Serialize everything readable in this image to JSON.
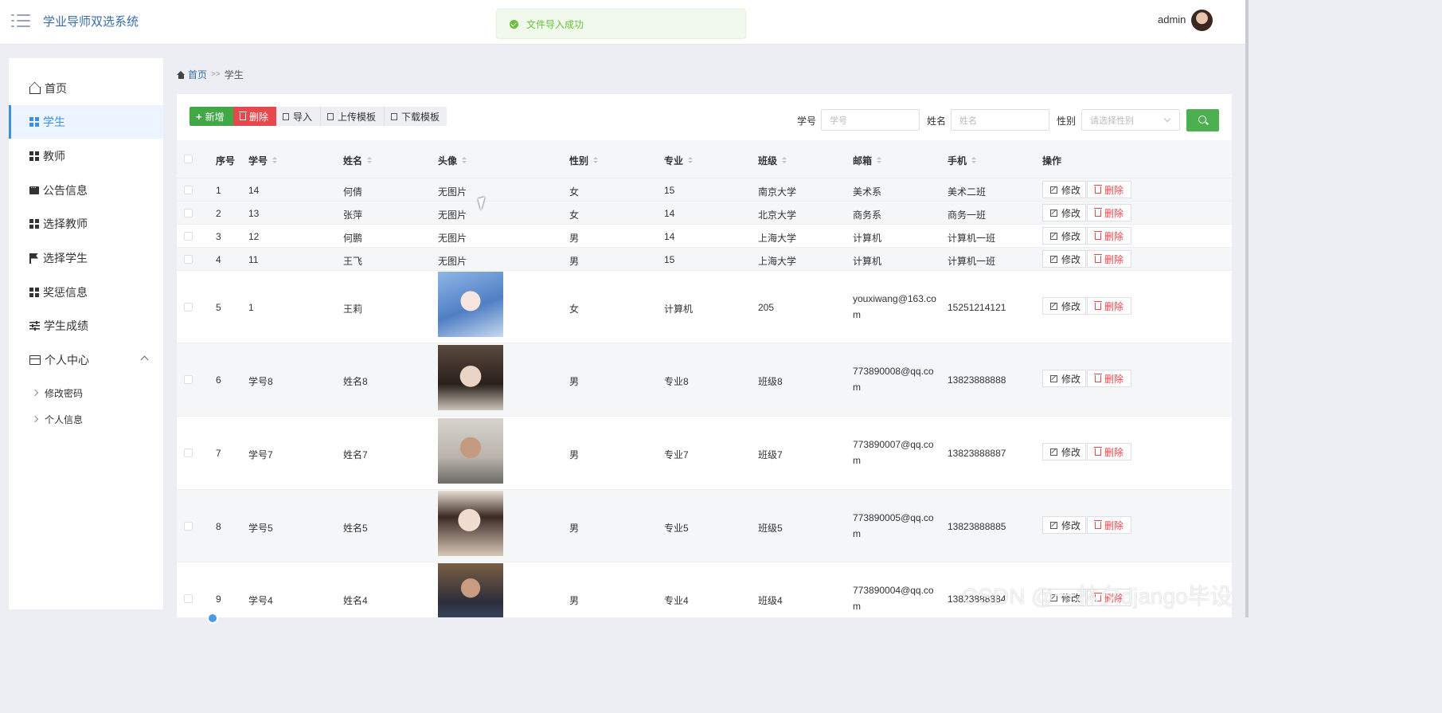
{
  "app": {
    "title": "学业导师双选系统",
    "user": "admin"
  },
  "toast": {
    "message": "文件导入成功"
  },
  "sidebar": {
    "items": [
      {
        "label": "首页",
        "icon": "home-icon"
      },
      {
        "label": "学生",
        "icon": "grid-icon",
        "active": true
      },
      {
        "label": "教师",
        "icon": "grid-icon"
      },
      {
        "label": "公告信息",
        "icon": "chat-icon"
      },
      {
        "label": "选择教师",
        "icon": "grid-icon"
      },
      {
        "label": "选择学生",
        "icon": "flag-icon"
      },
      {
        "label": "奖惩信息",
        "icon": "grid-icon"
      },
      {
        "label": "学生成绩",
        "icon": "sliders-icon"
      },
      {
        "label": "个人中心",
        "icon": "card-icon"
      }
    ],
    "sub_items": [
      {
        "label": "修改密码"
      },
      {
        "label": "个人信息"
      }
    ]
  },
  "breadcrumb": {
    "home": "首页",
    "sep": ">>",
    "current": "学生"
  },
  "toolbar": {
    "add": "新增",
    "delete": "删除",
    "import": "导入",
    "upload_template": "上传模板",
    "download_template": "下载模板"
  },
  "search": {
    "student_id_label": "学号",
    "student_id_placeholder": "学号",
    "name_label": "姓名",
    "name_placeholder": "姓名",
    "gender_label": "性别",
    "gender_placeholder": "请选择性别"
  },
  "table": {
    "columns": [
      "序号",
      "学号",
      "姓名",
      "头像",
      "性别",
      "专业",
      "班级",
      "邮箱",
      "手机",
      "操作"
    ],
    "edit_label": "修改",
    "delete_label": "删除",
    "rows": [
      {
        "no": "1",
        "sid": "14",
        "name": "何倩",
        "avatar": "无图片",
        "gender": "女",
        "major": "15",
        "cls": "南京大学",
        "email": "美术系",
        "phone": "美术二班"
      },
      {
        "no": "2",
        "sid": "13",
        "name": "张萍",
        "avatar": "无图片",
        "gender": "女",
        "major": "14",
        "cls": "北京大学",
        "email": "商务系",
        "phone": "商务一班"
      },
      {
        "no": "3",
        "sid": "12",
        "name": "何鹏",
        "avatar": "无图片",
        "gender": "男",
        "major": "14",
        "cls": "上海大学",
        "email": "计算机",
        "phone": "计算机一班"
      },
      {
        "no": "4",
        "sid": "11",
        "name": "王飞",
        "avatar": "无图片",
        "gender": "男",
        "major": "15",
        "cls": "上海大学",
        "email": "计算机",
        "phone": "计算机一班"
      },
      {
        "no": "5",
        "sid": "1",
        "name": "王莉",
        "avatar": "",
        "gender": "女",
        "major": "计算机",
        "cls": "205",
        "email": "youxiwang@163.com",
        "phone": "15251214121"
      },
      {
        "no": "6",
        "sid": "学号8",
        "name": "姓名8",
        "avatar": "",
        "gender": "男",
        "major": "专业8",
        "cls": "班级8",
        "email": "773890008@qq.com",
        "phone": "13823888888"
      },
      {
        "no": "7",
        "sid": "学号7",
        "name": "姓名7",
        "avatar": "",
        "gender": "男",
        "major": "专业7",
        "cls": "班级7",
        "email": "773890007@qq.com",
        "phone": "13823888887"
      },
      {
        "no": "8",
        "sid": "学号5",
        "name": "姓名5",
        "avatar": "",
        "gender": "男",
        "major": "专业5",
        "cls": "班级5",
        "email": "773890005@qq.com",
        "phone": "13823888885"
      },
      {
        "no": "9",
        "sid": "学号4",
        "name": "姓名4",
        "avatar": "",
        "gender": "男",
        "major": "专业4",
        "cls": "班级4",
        "email": "773890004@qq.com",
        "phone": "13823888884"
      }
    ]
  },
  "watermark": "CSDN @一林夕django毕设",
  "colors": {
    "accent": "#3a8ee6",
    "success": "#42a845",
    "danger": "#e5484d",
    "title": "#3a6ea5"
  }
}
